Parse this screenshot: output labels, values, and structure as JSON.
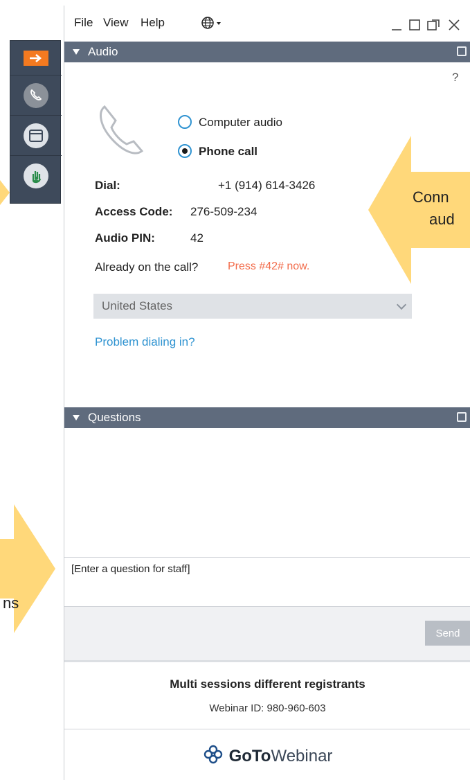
{
  "window": {
    "menu": [
      "File",
      "View",
      "Help"
    ],
    "globe_icon": "globe-icon"
  },
  "audio": {
    "title": "Audio",
    "help": "?",
    "options": [
      {
        "label": "Computer audio",
        "selected": false
      },
      {
        "label": "Phone call",
        "selected": true
      }
    ],
    "dial_label": "Dial:",
    "dial_value": "+1 (914) 614-3426",
    "access_label": "Access Code:",
    "access_value": "276-509-234",
    "pin_label": "Audio PIN:",
    "pin_value": "42",
    "already_text": "Already on the call?",
    "press_text": "Press #42# now.",
    "country": "United States",
    "problem_link": "Problem dialing in?"
  },
  "questions": {
    "title": "Questions",
    "placeholder": "[Enter a question for staff]",
    "send_label": "Send"
  },
  "footer": {
    "session_title": "Multi sessions different registrants",
    "webinar_id": "Webinar ID: 980-960-603",
    "brand_bold": "GoTo",
    "brand_light": "Webinar"
  },
  "callouts": {
    "right_line1": "Conn",
    "right_line2": "aud",
    "left_line": "ns"
  },
  "colors": {
    "accent": "#f47a20",
    "header": "#5f6b7d",
    "link": "#2f93d1",
    "warning": "#f26b4a"
  }
}
